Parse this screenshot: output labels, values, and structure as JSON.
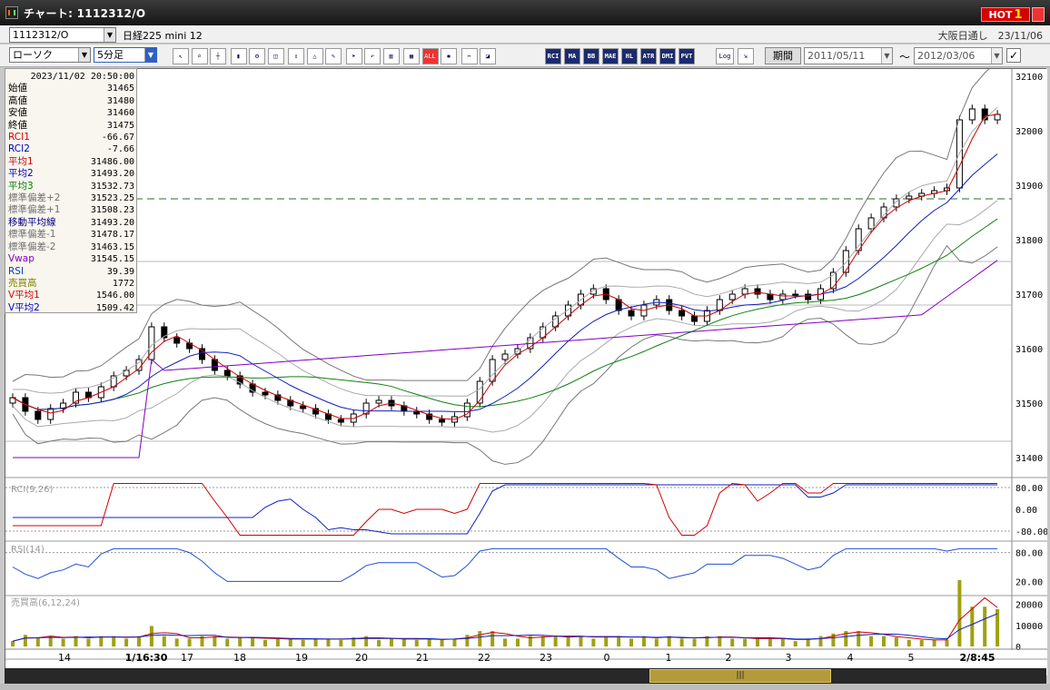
{
  "window": {
    "title": "チャート: 1112312/O",
    "hot_label": "HOT",
    "hot_number": "1"
  },
  "toolbar": {
    "symbol_value": "1112312/O",
    "market_label": "日経225 mini 12",
    "chart_type": "ローソク",
    "timeframe": "5分足",
    "period_label": "期間",
    "date_from": "2011/05/11",
    "date_sep": "～",
    "date_to": "2012/03/06",
    "exchange_info": "大阪日通し　23/11/06",
    "icons": [
      "pointer-icon",
      "zoom-icon",
      "crosshair-icon",
      "candle-settings-icon",
      "config-icon",
      "chart-view-icon",
      "split-icon",
      "hide-icon",
      "pen-icon",
      "cursor-icon",
      "undo-icon",
      "bar-icon",
      "chart2-icon",
      "all-icon",
      "gear-icon",
      "tools-icon",
      "color-icon"
    ],
    "indicator_buttons": [
      "RCI",
      "MA",
      "BB",
      "MAE",
      "HL",
      "ATR",
      "DMI",
      "PVT"
    ],
    "log_label": "Log"
  },
  "info_panel": {
    "datetime": "2023/11/02 20:50:00",
    "rows": [
      {
        "label": "始値",
        "value": "31465",
        "color": "#000"
      },
      {
        "label": "高値",
        "value": "31480",
        "color": "#000"
      },
      {
        "label": "安値",
        "value": "31460",
        "color": "#000"
      },
      {
        "label": "終値",
        "value": "31475",
        "color": "#000"
      },
      {
        "label": "RCI1",
        "value": "-66.67",
        "color": "#d00000"
      },
      {
        "label": "RCI2",
        "value": "-7.66",
        "color": "#0000c0"
      },
      {
        "label": "平均1",
        "value": "31486.00",
        "color": "#d00000"
      },
      {
        "label": "平均2",
        "value": "31493.20",
        "color": "#0000c0"
      },
      {
        "label": "平均3",
        "value": "31532.73",
        "color": "#008000"
      },
      {
        "label": "標準偏差+2",
        "value": "31523.25",
        "color": "#707070"
      },
      {
        "label": "標準偏差+1",
        "value": "31508.23",
        "color": "#707070"
      },
      {
        "label": "移動平均線",
        "value": "31493.20",
        "color": "#000080"
      },
      {
        "label": "標準偏差-1",
        "value": "31478.17",
        "color": "#707070"
      },
      {
        "label": "標準偏差-2",
        "value": "31463.15",
        "color": "#707070"
      },
      {
        "label": "Vwap",
        "value": "31545.15",
        "color": "#8000c0"
      },
      {
        "label": "RSI",
        "value": "39.39",
        "color": "#0040c0"
      },
      {
        "label": "売買高",
        "value": "1772",
        "color": "#808000"
      },
      {
        "label": "V平均1",
        "value": "1546.00",
        "color": "#d00000"
      },
      {
        "label": "V平均2",
        "value": "1509.42",
        "color": "#0000c0"
      }
    ]
  },
  "chart_data": {
    "type": "candlestick",
    "price_axis": {
      "ticks": [
        "32100",
        "32000",
        "31900",
        "31800",
        "31700",
        "31600",
        "31500",
        "31400"
      ]
    },
    "dashed_level": 31875,
    "rci": {
      "label": "RCI(9,26)",
      "ticks": [
        "80.00",
        "0.00",
        "-80.00"
      ]
    },
    "rsi": {
      "label": "RSI(14)",
      "ticks": [
        "80.00",
        "20.00"
      ]
    },
    "volume": {
      "label": "売買高(6,12,24)",
      "ticks": [
        "20000",
        "10000",
        "0"
      ]
    },
    "x_labels": [
      "14",
      "1/16:30",
      "17",
      "18",
      "19",
      "20",
      "21",
      "22",
      "23",
      "0",
      "1",
      "2",
      "3",
      "4",
      "5",
      "2/8:45"
    ],
    "closes": [
      31510,
      31485,
      31470,
      31490,
      31500,
      31520,
      31510,
      31530,
      31550,
      31560,
      31580,
      31640,
      31620,
      31610,
      31600,
      31580,
      31560,
      31550,
      31535,
      31520,
      31515,
      31505,
      31495,
      31490,
      31480,
      31470,
      31465,
      31480,
      31500,
      31505,
      31495,
      31485,
      31480,
      31470,
      31465,
      31475,
      31500,
      31540,
      31580,
      31590,
      31600,
      31620,
      31640,
      31660,
      31680,
      31700,
      31710,
      31690,
      31670,
      31660,
      31680,
      31690,
      31670,
      31660,
      31650,
      31670,
      31690,
      31700,
      31710,
      31700,
      31690,
      31700,
      31700,
      31690,
      31710,
      31740,
      31780,
      31820,
      31840,
      31860,
      31875,
      31880,
      31885,
      31890,
      31895,
      32020,
      32040,
      32020,
      32030
    ]
  }
}
